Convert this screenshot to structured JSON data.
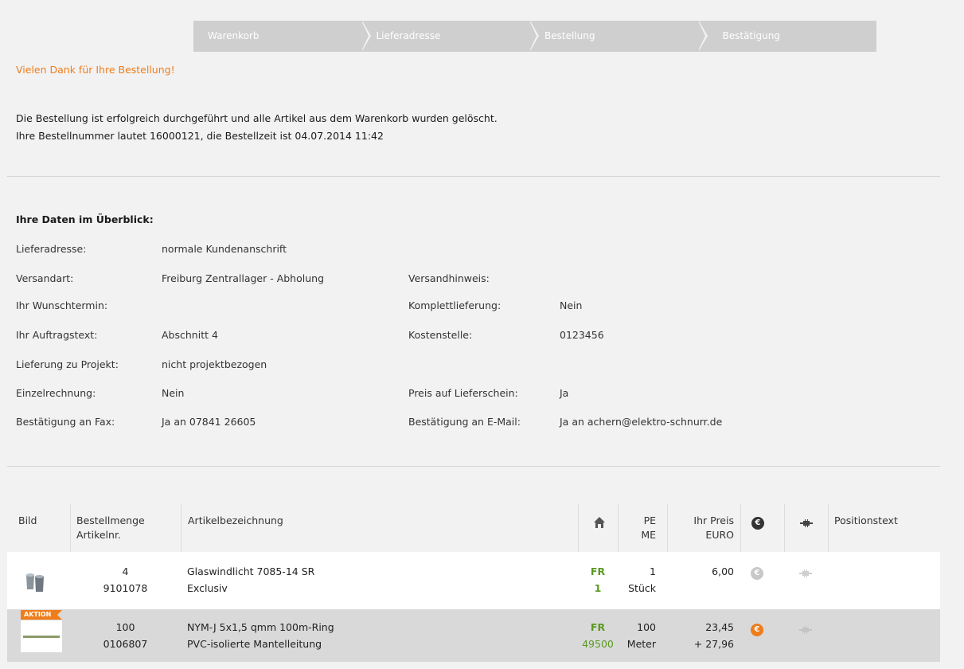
{
  "steps": [
    "Warenkorb",
    "Lieferadresse",
    "Bestellung",
    "Bestätigung"
  ],
  "thanks": "Vielen Dank für Ihre Bestellung!",
  "message_line1": "Die Bestellung ist erfolgreich durchgeführt und alle Artikel aus dem Warenkorb wurden gelöscht.",
  "message_line2": "Ihre Bestellnummer lautet 16000121, die Bestellzeit ist 04.07.2014 11:42",
  "overview": {
    "title": "Ihre Daten im Überblick:",
    "lieferadresse_label": "Lieferadresse:",
    "lieferadresse_value": "normale Kundenanschrift",
    "versandart_label": "Versandart:",
    "versandart_value": "Freiburg Zentrallager - Abholung",
    "versandhinweis_label": "Versandhinweis:",
    "versandhinweis_value": "",
    "wunschtermin_label": "Ihr Wunschtermin:",
    "wunschtermin_value": "",
    "komplett_label": "Komplettlieferung:",
    "komplett_value": "Nein",
    "auftragstext_label": "Ihr Auftragstext:",
    "auftragstext_value": "Abschnitt 4",
    "kostenstelle_label": "Kostenstelle:",
    "kostenstelle_value": "0123456",
    "projekt_label": "Lieferung zu Projekt:",
    "projekt_value": "nicht projektbezogen",
    "einzel_label": "Einzelrechnung:",
    "einzel_value": "Nein",
    "preis_label": "Preis auf Lieferschein:",
    "preis_value": "Ja",
    "fax_label": "Bestätigung an Fax:",
    "fax_value": "Ja an 07841 26605",
    "email_label": "Bestätigung an E-Mail:",
    "email_value": "Ja an achern@elektro-schnurr.de"
  },
  "table": {
    "headers": {
      "bild": "Bild",
      "menge_1": "Bestellmenge",
      "menge_2": "Artikelnr.",
      "bezeichnung": "Artikelbezeichnung",
      "pe": "PE",
      "me": "ME",
      "preis_1": "Ihr Preis",
      "preis_2": "EURO",
      "positionstext": "Positionstext"
    },
    "rows": [
      {
        "qty": "4",
        "artnr": "9101078",
        "name": "Glaswindlicht 7085-14 SR",
        "name2": "Exclusiv",
        "loc": "FR",
        "stock": "1",
        "pe": "1",
        "me": "Stück",
        "price": "6,00",
        "price2": "",
        "badge": ""
      },
      {
        "qty": "100",
        "artnr": "0106807",
        "name": "NYM-J 5x1,5 qmm 100m-Ring",
        "name2": "PVC-isolierte Mantelleitung",
        "loc": "FR",
        "stock": "49500",
        "pe": "100",
        "me": "Meter",
        "price": "23,45",
        "price2": "+ 27,96",
        "badge": "AKTION"
      }
    ]
  },
  "icons": {
    "house": "house-icon",
    "euro": "euro-icon",
    "plug": "plug-icon"
  },
  "colors": {
    "accent_orange": "#ef7d1a",
    "stock_green": "#5a9a22",
    "step_bg": "#cfcfcf"
  }
}
